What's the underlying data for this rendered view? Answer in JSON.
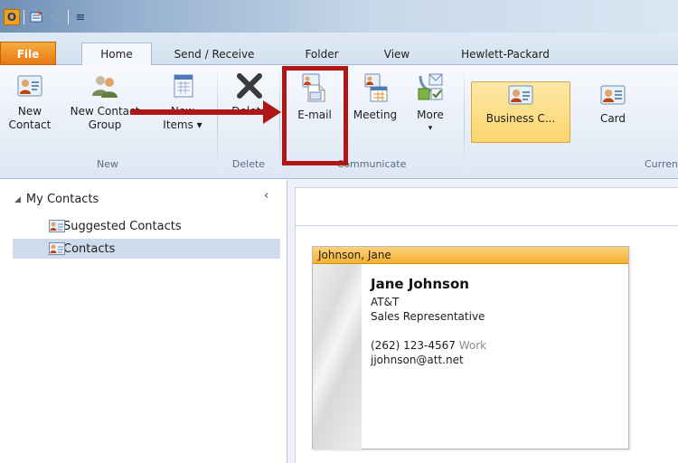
{
  "quick_access": {
    "app_icon_letter": "O",
    "customize_label": "≡"
  },
  "tabs": {
    "file": "File",
    "home": "Home",
    "send_receive": "Send / Receive",
    "folder": "Folder",
    "view": "View",
    "hewlett": "Hewlett-Packard"
  },
  "ribbon": {
    "new_group": {
      "label": "New",
      "new_contact": [
        "New",
        "Contact"
      ],
      "new_contact_group": [
        "New Contact",
        "Group"
      ],
      "new_items": [
        "New",
        "Items ▾"
      ]
    },
    "delete_group": {
      "label": "Delete",
      "delete": "Delete"
    },
    "communicate_group": {
      "label": "Communicate",
      "email": "E-mail",
      "meeting": "Meeting",
      "more": "More",
      "more_arrow": "▾"
    },
    "current_view_group": {
      "label": "Curren",
      "business_card": "Business C...",
      "card": "Card"
    }
  },
  "nav": {
    "header": "My Contacts",
    "collapse": "‹",
    "items": [
      "Suggested Contacts",
      "Contacts"
    ]
  },
  "contact_card": {
    "header": "Johnson, Jane",
    "name": "Jane Johnson",
    "company": "AT&T",
    "title": "Sales Representative",
    "phone": "(262) 123-4567",
    "phone_type": "Work",
    "email": "jjohnson@att.net"
  },
  "colors": {
    "highlight": "#b01616",
    "file_tab": "#e8770e",
    "card_header": "#f5b02d"
  }
}
